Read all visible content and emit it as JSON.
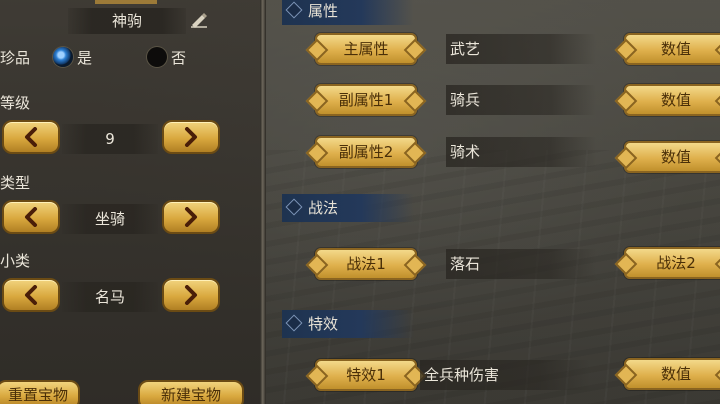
{
  "left": {
    "name": "神驹",
    "treasure": {
      "label": "珍品",
      "yes": "是",
      "no": "否",
      "selected": "yes"
    },
    "level": {
      "label": "等级",
      "value": "9"
    },
    "type": {
      "label": "类型",
      "value": "坐骑"
    },
    "subtype": {
      "label": "小类",
      "value": "名马"
    },
    "buttons": {
      "reset": "重置宝物",
      "create": "新建宝物"
    }
  },
  "sections": {
    "attributes": {
      "title": "属性",
      "rows": [
        {
          "label": "主属性",
          "value": "武艺",
          "action": "数值"
        },
        {
          "label": "副属性1",
          "value": "骑兵",
          "action": "数值"
        },
        {
          "label": "副属性2",
          "value": "骑术",
          "action": "数值"
        }
      ]
    },
    "tactics": {
      "title": "战法",
      "rows": [
        {
          "label": "战法1",
          "value": "落石",
          "action": "战法2"
        }
      ]
    },
    "effects": {
      "title": "特效",
      "rows": [
        {
          "label": "特效1",
          "value": "全兵种伤害",
          "action": "数值"
        }
      ]
    }
  },
  "colors": {
    "gold": "#dfb04c",
    "header_blue": "#24395a",
    "radio_on": "#2d7fd3"
  },
  "icons": {
    "left_arrow": "chevron-left-icon",
    "right_arrow": "chevron-right-icon",
    "edit": "edit-icon"
  }
}
